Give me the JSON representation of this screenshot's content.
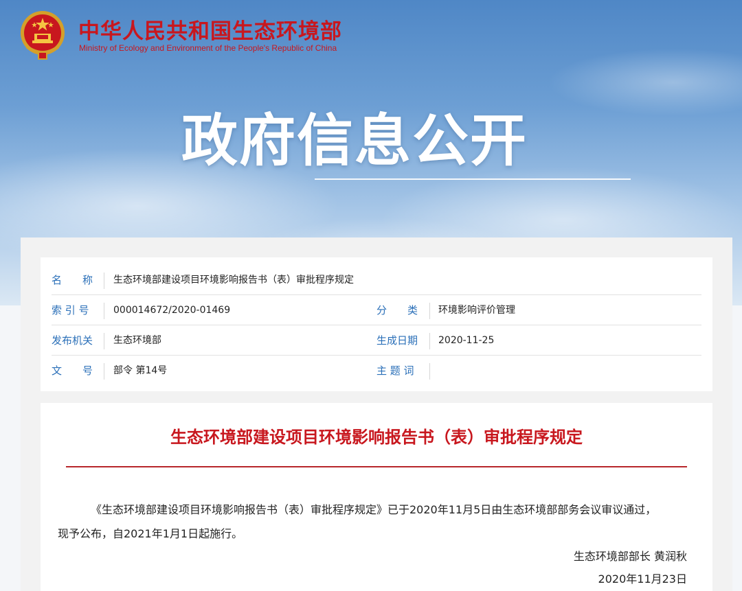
{
  "header": {
    "ministry_cn": "中华人民共和国生态环境部",
    "ministry_en": "Ministry of Ecology and Environment of the People's Republic of China",
    "emblem_icon": "national-emblem-icon",
    "hero_title": "政府信息公开",
    "brand_color": "#c8171e"
  },
  "info": {
    "name_label": "名　　称",
    "name_value": "生态环境部建设项目环境影响报告书（表）审批程序规定",
    "index_label": "索 引 号",
    "index_value": "000014672/2020-01469",
    "category_label": "分　　类",
    "category_value": "环境影响评价管理",
    "publisher_label": "发布机关",
    "publisher_value": "生态环境部",
    "date_label": "生成日期",
    "date_value": "2020-11-25",
    "docno_label": "文　　号",
    "docno_value": "部令 第14号",
    "keywords_label": "主 题 词",
    "keywords_value": ""
  },
  "document": {
    "title": "生态环境部建设项目环境影响报告书（表）审批程序规定",
    "para_line1": "《生态环境部建设项目环境影响报告书（表）审批程序规定》已于2020年11月5日由生态环境部部务会议审议通过，",
    "para_line2": "现予公布，自2021年1月1日起施行。",
    "signatory": "生态环境部部长 黄润秋",
    "sign_date": "2020年11月23日"
  }
}
